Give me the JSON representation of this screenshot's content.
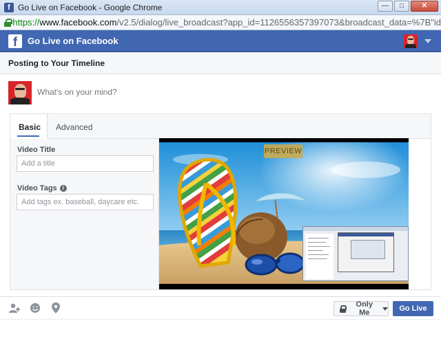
{
  "window": {
    "title": "Go Live on Facebook - Google Chrome",
    "favicon_letter": "f",
    "controls": {
      "minimize": "—",
      "maximize": "□",
      "close": "✕"
    }
  },
  "address_bar": {
    "scheme": "https://",
    "host": "www.facebook.com",
    "path": "/v2.5/dialog/live_broadcast?app_id=1126556357397073&broadcast_data=%7B\"id"
  },
  "header": {
    "logo_letter": "f",
    "title": "Go Live on Facebook"
  },
  "posting_to": "Posting to Your Timeline",
  "composer": {
    "placeholder": "What's on your mind?"
  },
  "tabs": [
    {
      "label": "Basic",
      "active": true
    },
    {
      "label": "Advanced",
      "active": false
    }
  ],
  "form": {
    "video_title_label": "Video Title",
    "video_title_placeholder": "Add a title",
    "video_tags_label": "Video Tags",
    "video_tags_info": "i",
    "video_tags_placeholder": "Add tags ex. baseball, daycare etc."
  },
  "preview": {
    "badge": "PREVIEW"
  },
  "footer": {
    "icons": [
      "tag-people-icon",
      "feeling-icon",
      "location-icon"
    ],
    "privacy_label": "Only Me",
    "go_live_label": "Go Live"
  },
  "colors": {
    "facebook_blue": "#4267b2",
    "header_border": "#29487d",
    "avatar_red": "#d8232a"
  }
}
